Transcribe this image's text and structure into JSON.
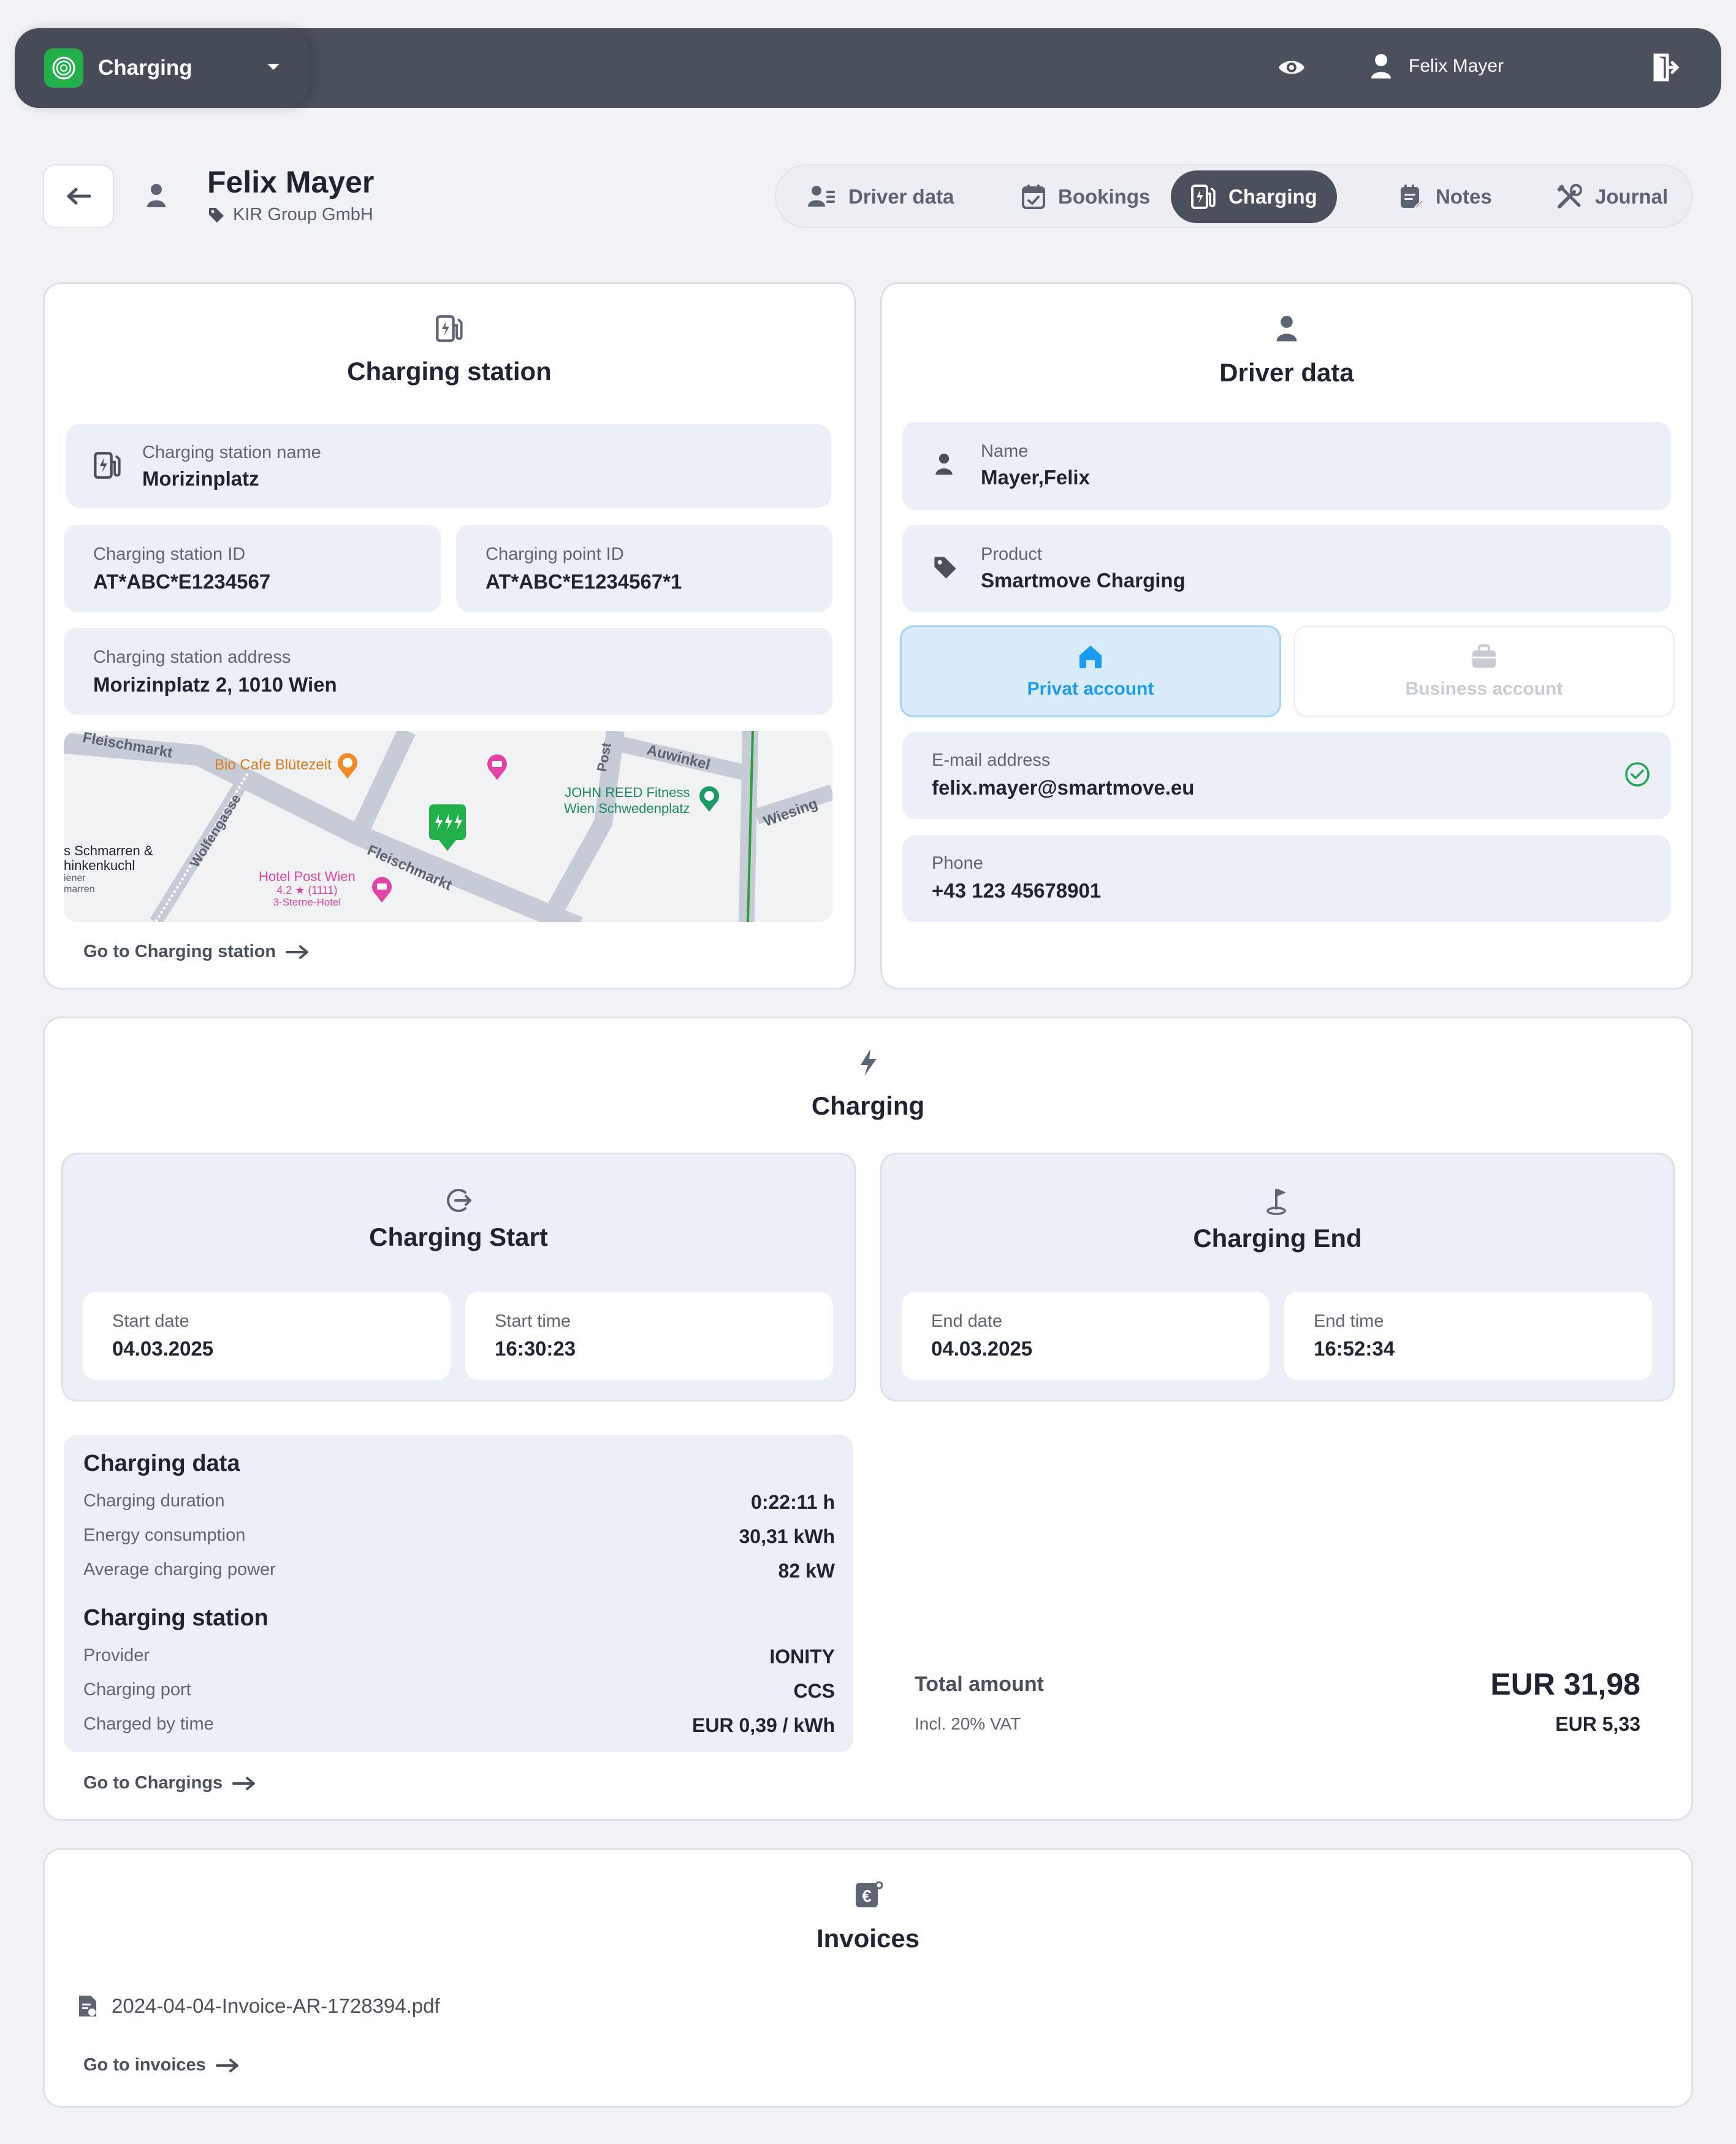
{
  "topbar": {
    "app_name": "Charging",
    "user_name": "Felix Mayer"
  },
  "header": {
    "name": "Felix Mayer",
    "company": "KIR Group GmbH"
  },
  "tabs": [
    {
      "label": "Driver data",
      "icon": "driver-data-icon"
    },
    {
      "label": "Bookings",
      "icon": "calendar-check-icon"
    },
    {
      "label": "Charging",
      "icon": "charging-station-icon",
      "active": true
    },
    {
      "label": "Notes",
      "icon": "notes-icon"
    },
    {
      "label": "Journal",
      "icon": "tools-icon"
    }
  ],
  "station_card": {
    "title": "Charging station",
    "name_label": "Charging station name",
    "name_value": "Morizinplatz",
    "station_id_label": "Charging station ID",
    "station_id_value": "AT*ABC*E1234567",
    "point_id_label": "Charging point ID",
    "point_id_value": "AT*ABC*E1234567*1",
    "address_label": "Charging station address",
    "address_value": "Morizinplatz 2, 1010 Wien",
    "link": "Go to Charging station",
    "map_labels": {
      "street_fleischmarkt_1": "Fleischmarkt",
      "street_fleischmarkt_2": "Fleischmarkt",
      "street_wolfengasse": "Wolfengasse",
      "street_auwinkel": "Auwinkel",
      "street_post": "Post",
      "street_wiesing": "Wiesing",
      "poi_bio_cafe": "Bio Cafe Blütezeit",
      "poi_john_reed_1": "JOHN REED Fitness",
      "poi_john_reed_2": "Wien Schwedenplatz",
      "poi_schmarren_1": "s Schmarren &",
      "poi_schmarren_2": "hinkenkuchl",
      "poi_schmarren_3": "iener",
      "poi_schmarren_4": "marren",
      "poi_hotel_1": "Hotel Post Wien",
      "poi_hotel_2": "4.2 ★ (1111)",
      "poi_hotel_3": "3-Sterne-Hotel"
    }
  },
  "driver_card": {
    "title": "Driver data",
    "name_label": "Name",
    "name_value": "Mayer,Felix",
    "product_label": "Product",
    "product_value": "Smartmove Charging",
    "private_account": "Privat account",
    "business_account": "Business account",
    "email_label": "E-mail address",
    "email_value": "felix.mayer@smartmove.eu",
    "phone_label": "Phone",
    "phone_value": "+43 123 45678901"
  },
  "charging_card": {
    "title": "Charging",
    "start": {
      "title": "Charging Start",
      "date_label": "Start date",
      "date_value": "04.03.2025",
      "time_label": "Start time",
      "time_value": "16:30:23"
    },
    "end": {
      "title": "Charging End",
      "date_label": "End date",
      "date_value": "04.03.2025",
      "time_label": "End time",
      "time_value": "16:52:34"
    },
    "data_heading": "Charging data",
    "data_rows": [
      {
        "key": "Charging duration",
        "value": "0:22:11 h"
      },
      {
        "key": "Energy consumption",
        "value": "30,31 kWh"
      },
      {
        "key": "Average charging power",
        "value": "82 kW"
      }
    ],
    "station_heading": "Charging station",
    "station_rows": [
      {
        "key": "Provider",
        "value": "IONITY"
      },
      {
        "key": "Charging port",
        "value": "CCS"
      },
      {
        "key": "Charged by time",
        "value": "EUR 0,39 / kWh"
      }
    ],
    "total_label": "Total amount",
    "total_value": "EUR 31,98",
    "vat_label": "Incl. 20% VAT",
    "vat_value": "EUR 5,33",
    "link": "Go to Chargings"
  },
  "invoices_card": {
    "title": "Invoices",
    "file_name": "2024-04-04-Invoice-AR-1728394.pdf",
    "link": "Go to invoices"
  },
  "colors": {
    "topbar": "#4a505c",
    "brand_green": "#22b04b",
    "accent_blue": "#1d9bf0",
    "field_bg": "#eceff5",
    "success_green": "#22a559"
  }
}
